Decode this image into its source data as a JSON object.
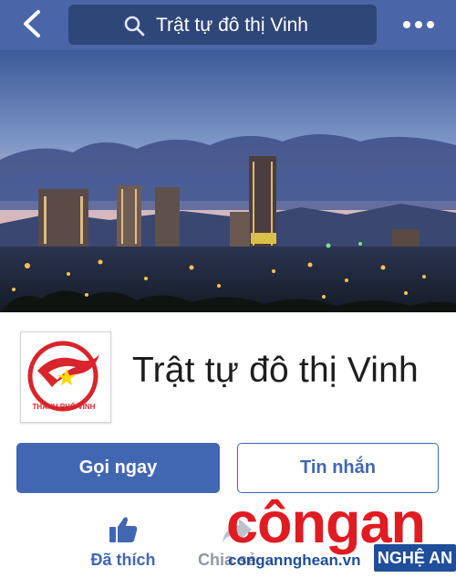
{
  "header": {
    "search_text": "Trật tự đô thị Vinh",
    "back_icon": "chevron-left-icon",
    "search_icon": "search-icon",
    "more_icon": "more-horizontal-icon",
    "bar_color": "#4a66a8"
  },
  "page": {
    "name": "Trật tự đô thị Vinh",
    "logo_text": "THÀNH PHỐ VINH"
  },
  "actions": {
    "call_label": "Gọi ngay",
    "message_label": "Tin nhắn",
    "like_label": "Đã thích",
    "share_label": "Chia sẻ",
    "accent_color": "#4267b2"
  },
  "watermark": {
    "brand": "côngan",
    "url": "congannghean.vn",
    "badge": "NGHỆ AN"
  }
}
